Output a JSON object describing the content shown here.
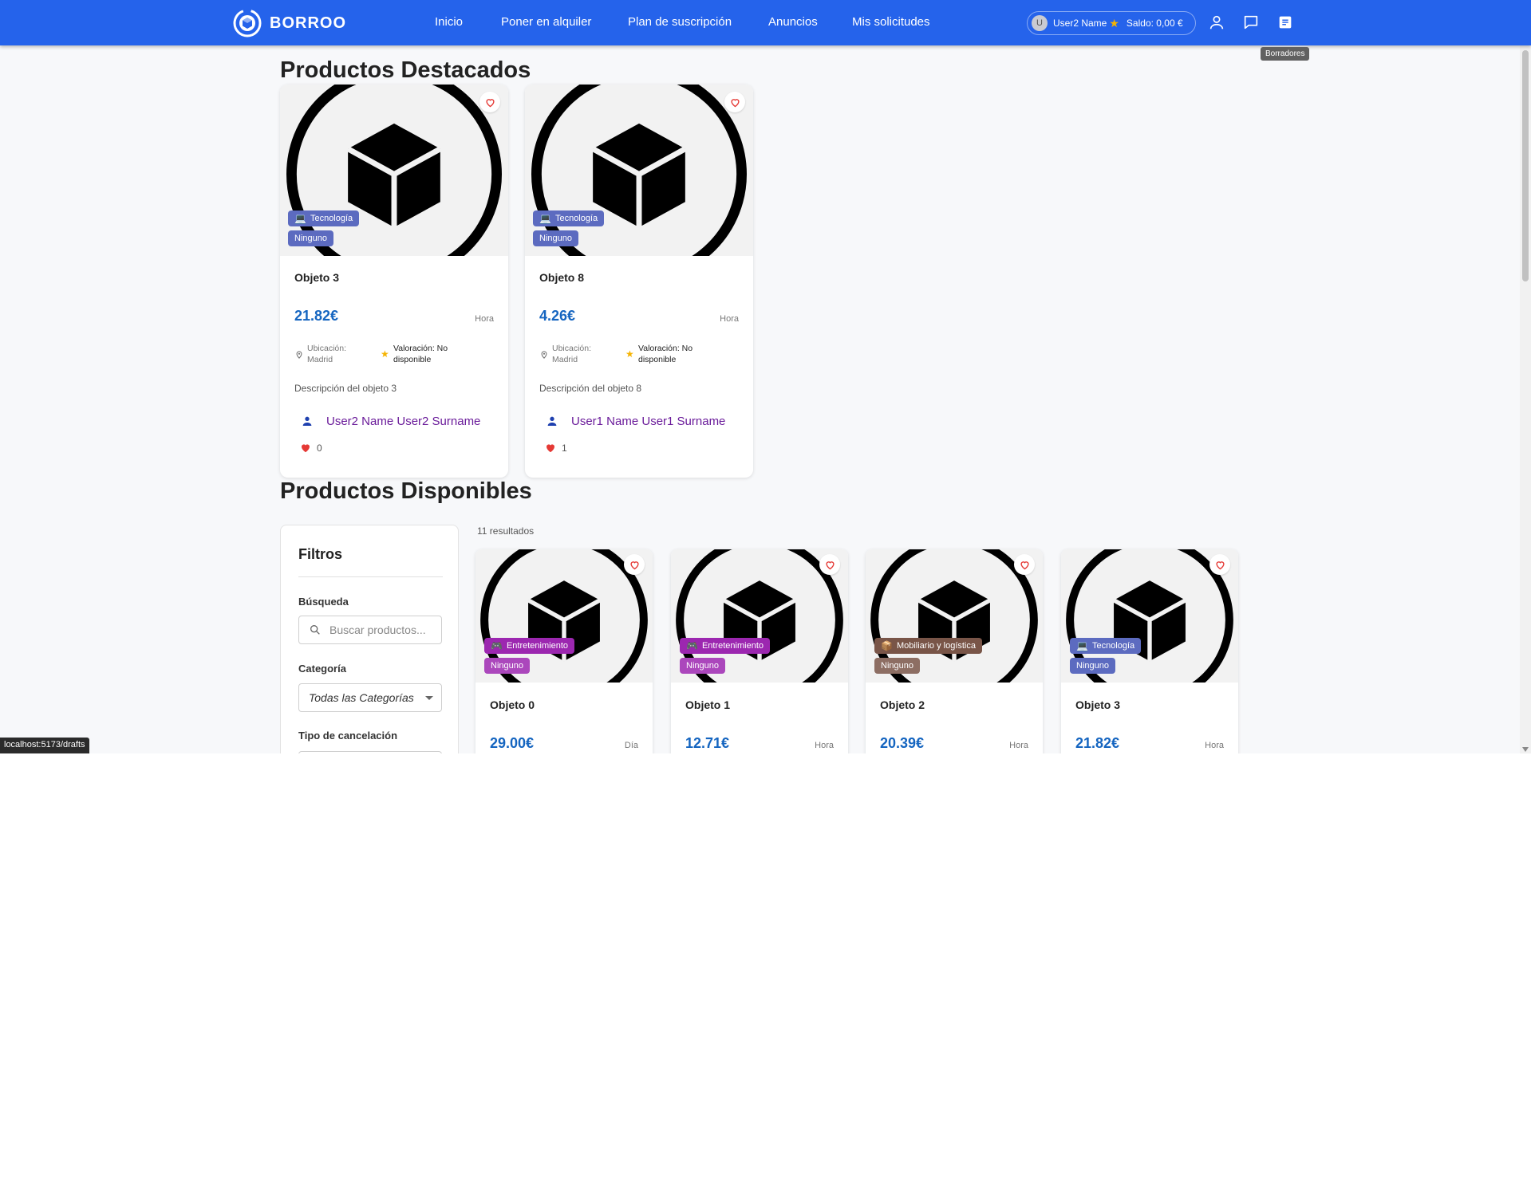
{
  "app": {
    "name": "BORROO"
  },
  "nav": {
    "items": [
      "Inicio",
      "Poner en alquiler",
      "Plan de suscripción",
      "Anuncios",
      "Mis solicitudes"
    ]
  },
  "user": {
    "avatar_letter": "U",
    "name": "User2 Name",
    "balance": "Saldo: 0,00 €"
  },
  "header_icons": [
    "user-icon",
    "chat-icon",
    "drafts-icon"
  ],
  "tooltip": "Borradores",
  "featured": {
    "title": "Productos Destacados",
    "cards": [
      {
        "category": "Tecnología",
        "category_emoji": "💻",
        "category_color": "#5c6bc0",
        "cancellation": "Ninguno",
        "name": "Objeto 3",
        "price": "21.82€",
        "unit": "Hora",
        "location_label": "Ubicación:",
        "location": "Madrid",
        "rating_label": "Valoración: No",
        "rating_value": "disponible",
        "description": "Descripción del objeto 3",
        "owner": "User2 Name User2 Surname",
        "likes": "0"
      },
      {
        "category": "Tecnología",
        "category_emoji": "💻",
        "category_color": "#5c6bc0",
        "cancellation": "Ninguno",
        "name": "Objeto 8",
        "price": "4.26€",
        "unit": "Hora",
        "location_label": "Ubicación:",
        "location": "Madrid",
        "rating_label": "Valoración: No",
        "rating_value": "disponible",
        "description": "Descripción del objeto 8",
        "owner": "User1 Name User1 Surname",
        "likes": "1"
      }
    ]
  },
  "available": {
    "title": "Productos Disponibles",
    "results": "11 resultados",
    "cards": [
      {
        "category": "Entretenimiento",
        "category_emoji": "🎮",
        "category_color": "#9c27b0",
        "cancellation_color": "#ab47bc",
        "cancellation": "Ninguno",
        "name": "Objeto 0",
        "price": "29.00€",
        "unit": "Día"
      },
      {
        "category": "Entretenimiento",
        "category_emoji": "🎮",
        "category_color": "#9c27b0",
        "cancellation_color": "#ab47bc",
        "cancellation": "Ninguno",
        "name": "Objeto 1",
        "price": "12.71€",
        "unit": "Hora"
      },
      {
        "category": "Mobiliario y logística",
        "category_emoji": "📦",
        "category_color": "#795548",
        "cancellation_color": "#8d6e63",
        "cancellation": "Ninguno",
        "name": "Objeto 2",
        "price": "20.39€",
        "unit": "Hora"
      },
      {
        "category": "Tecnología",
        "category_emoji": "💻",
        "category_color": "#5c6bc0",
        "cancellation_color": "#5c6bc0",
        "cancellation": "Ninguno",
        "name": "Objeto 3",
        "price": "21.82€",
        "unit": "Hora"
      }
    ]
  },
  "filters": {
    "title": "Filtros",
    "search_label": "Búsqueda",
    "search_placeholder": "Buscar productos...",
    "category_label": "Categoría",
    "category_value": "Todas las Categorías",
    "cancel_label": "Tipo de cancelación"
  },
  "status_url": "localhost:5173/drafts",
  "colors": {
    "primary": "#2563eb",
    "price": "#1565c0",
    "owner": "#6a1b9a",
    "heart": "#e53935"
  }
}
